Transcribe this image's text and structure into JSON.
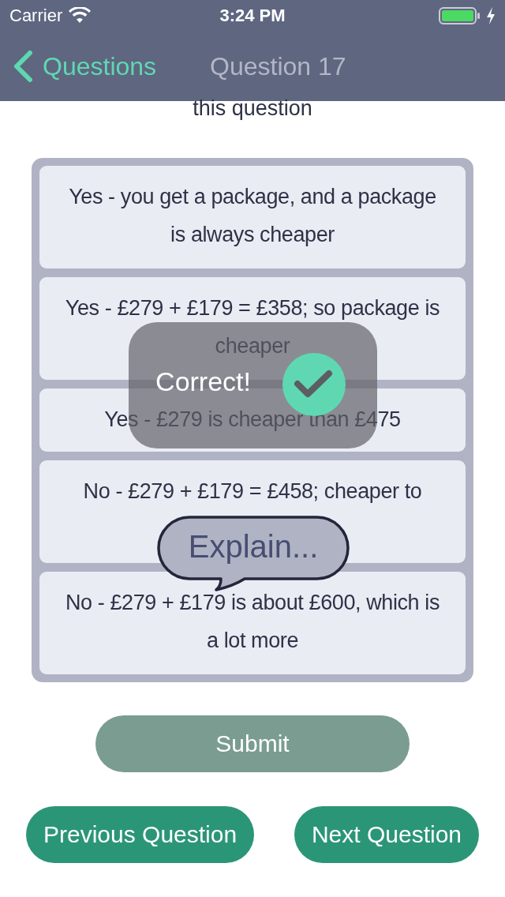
{
  "status_bar": {
    "carrier": "Carrier",
    "time": "3:24 PM",
    "charging": true
  },
  "nav_bar": {
    "back": "Questions",
    "title": "Question 17"
  },
  "prompt": "this question",
  "options": [
    {
      "text": "Yes - you get a package, and a package is always cheaper"
    },
    {
      "text": "Yes - £279 + £179 = £358; so package is cheaper"
    },
    {
      "text": "Yes - £279 is cheaper than £475"
    },
    {
      "text": "No - £279 + £179 = £458; cheaper to"
    },
    {
      "text": "No - £279 + £179 is about £600, which is a lot more"
    }
  ],
  "feedback": {
    "text": "Correct!",
    "correct": true
  },
  "explain_button": "Explain...",
  "submit": {
    "label": "Submit",
    "disabled": true
  },
  "buttons": [
    {
      "label": "Previous Question"
    },
    {
      "label": "Next Question"
    }
  ]
}
